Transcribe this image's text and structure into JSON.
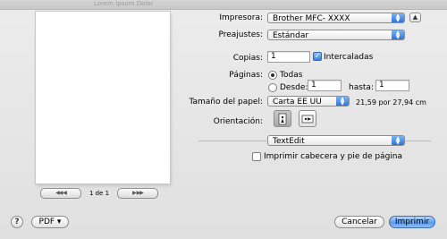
{
  "window": {
    "ghost_title": "Lorem Ipsum Dolor"
  },
  "preview": {
    "page_indicator": "1 de 1",
    "first_prev": "◀◀  ◀",
    "next_last": "▶  ▶▶"
  },
  "printer": {
    "label": "Impresora:",
    "value": "Brother MFC- XXXX",
    "disclosure": "▲"
  },
  "presets": {
    "label": "Preajustes:",
    "value": "Estándar"
  },
  "copies": {
    "label": "Copias:",
    "value": "1",
    "collate_label": "Intercaladas",
    "collate_checked": true
  },
  "pages": {
    "label": "Páginas:",
    "all_label": "Todas",
    "from_label": "Desde:",
    "from_value": "1",
    "to_label": "hasta:",
    "to_value": "1"
  },
  "paper": {
    "label": "Tamaño del papel:",
    "value": "Carta EE UU",
    "dimensions": "21,59 por 27,94 cm"
  },
  "orientation": {
    "label": "Orientación:"
  },
  "app_menu": {
    "value": "TextEdit"
  },
  "header_footer": {
    "label": "Imprimir cabecera y pie de página",
    "checked": false
  },
  "footer": {
    "help": "?",
    "pdf_label": "PDF ▾",
    "cancel_label": "Cancelar",
    "print_label": "Imprimir"
  },
  "colors": {
    "accent": "#3a7fe0",
    "panel": "#e8e8e8"
  }
}
